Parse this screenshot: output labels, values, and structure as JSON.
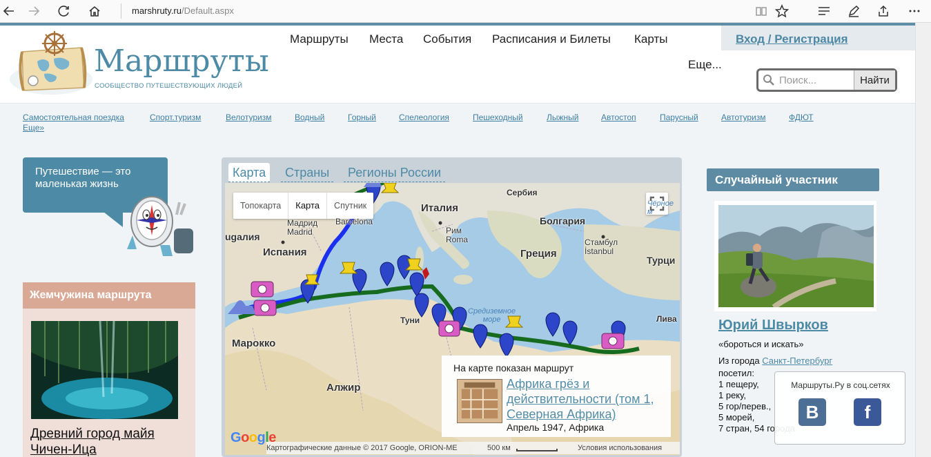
{
  "browser": {
    "url_host": "marshruty.ru",
    "url_path": "/Default.aspx"
  },
  "site": {
    "logo_title": "Маршруты",
    "logo_subtitle": "СООБЩЕСТВО ПУТЕШЕСТВУЮЩИХ ЛЮДЕЙ"
  },
  "nav": {
    "items": [
      "Маршруты",
      "Места",
      "События",
      "Расписания и Билеты",
      "Карты"
    ],
    "more": "Еще...",
    "login": "Вход / Регистрация"
  },
  "search": {
    "placeholder": "Поиск...",
    "button": "Найти"
  },
  "categories": {
    "items": [
      "Самостоятельная поездка",
      "Спорт.туризм",
      "Велотуризм",
      "Водный",
      "Горный",
      "Спелеология",
      "Пешеходный",
      "Лыжный",
      "Автостоп",
      "Парусный",
      "Автотуризм",
      "ФДЮТ"
    ],
    "more": "Еще»"
  },
  "quote": {
    "text": "Путешествие — это маленькая жизнь"
  },
  "pearl": {
    "heading": "Жемчужина маршрута",
    "title_line1": "Древний город майя",
    "title_line2": "Чичен-Ица"
  },
  "map_widget": {
    "tabs": [
      "Карта",
      "Страны",
      "Регионы России"
    ],
    "map_types": [
      "Топокарта",
      "Карта",
      "Спутник"
    ],
    "labels": {
      "serbia": "Сербия",
      "italy": "Италия",
      "bulgaria": "Болгария",
      "spain": "Испания",
      "portugal": "ugалия",
      "greece": "Греция",
      "turkey": "Турци",
      "morocco": "Марокко",
      "algeria": "Алжир",
      "libya": "Лива",
      "tunisia": "Туни",
      "madrid": "Мадрид\nMadrid",
      "barcelona": "Barcelona",
      "rome": "Рим\nRoma",
      "istanbul": "Стамбул\nİstanbul",
      "black_sea": "Чёрное м",
      "med_sea": "Средиземное\nморе"
    },
    "popup": {
      "caption": "На карте показан маршрут",
      "link": "Африка грёз и действительности (том 1, Северная Африка)",
      "meta": "Апрель 1947, Африка"
    },
    "footer": {
      "attribution": "Картографические данные © 2017 Google, ORION-ME",
      "scale": "500 км",
      "terms": "Условия использования"
    },
    "google": "Google"
  },
  "member": {
    "heading": "Случайный участник",
    "name": "Юрий Швырков",
    "motto": "«бороться и искать»",
    "from_label": "Из города ",
    "city": "Санкт-Петербург",
    "visited": [
      "посетил:",
      "1 пещеру,",
      "1 реку,",
      "5 гор/перев.,",
      "5 морей,",
      "7 стран, 54 города"
    ]
  },
  "social": {
    "title": "Маршруты.Ру в соц.сетях",
    "vk": "B",
    "fb": "f"
  }
}
